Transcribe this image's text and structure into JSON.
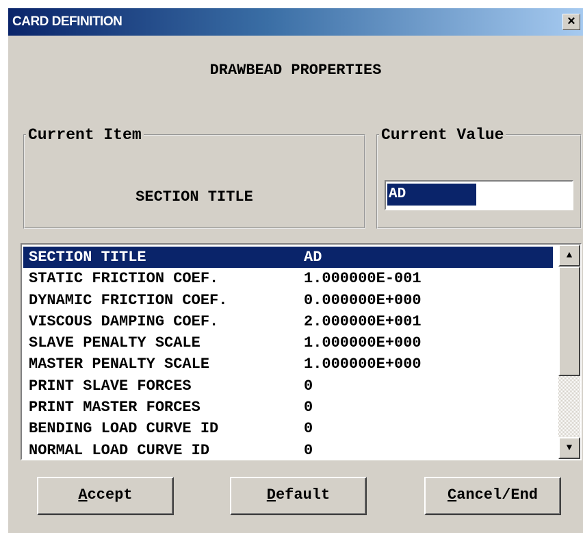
{
  "window": {
    "title": "CARD DEFINITION",
    "close_label": "×"
  },
  "heading": "DRAWBEAD PROPERTIES",
  "current_item": {
    "legend": "Current Item",
    "text": "SECTION TITLE"
  },
  "current_value": {
    "legend": "Current Value",
    "value": "AD"
  },
  "list": {
    "rows": [
      {
        "label": "SECTION TITLE",
        "value": "AD",
        "selected": true
      },
      {
        "label": "STATIC FRICTION COEF.",
        "value": "1.000000E-001"
      },
      {
        "label": "DYNAMIC FRICTION COEF.",
        "value": "0.000000E+000"
      },
      {
        "label": "VISCOUS DAMPING COEF.",
        "value": "2.000000E+001"
      },
      {
        "label": "SLAVE PENALTY SCALE",
        "value": "1.000000E+000"
      },
      {
        "label": "MASTER PENALTY SCALE",
        "value": "1.000000E+000"
      },
      {
        "label": "PRINT SLAVE FORCES",
        "value": "0"
      },
      {
        "label": "PRINT MASTER FORCES",
        "value": "0"
      },
      {
        "label": "BENDING LOAD CURVE ID",
        "value": "0"
      },
      {
        "label": "NORMAL LOAD CURVE ID",
        "value": "0"
      }
    ],
    "scroll_up_icon": "▲",
    "scroll_down_icon": "▼"
  },
  "buttons": {
    "accept": {
      "hotkey": "A",
      "rest": "ccept"
    },
    "default": {
      "hotkey": "D",
      "rest": "efault"
    },
    "cancel": {
      "hotkey": "C",
      "rest": "ancel/End"
    }
  }
}
